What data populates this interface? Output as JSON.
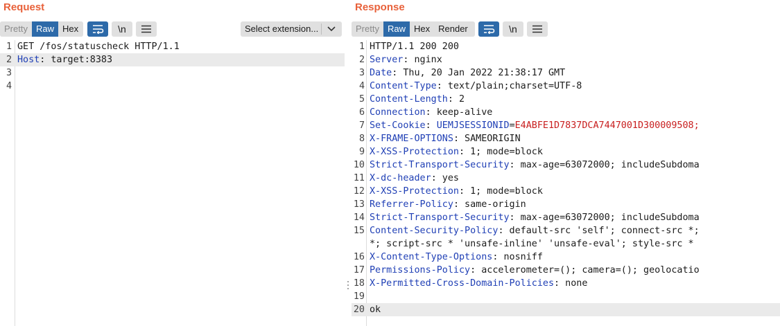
{
  "request": {
    "title": "Request",
    "view_tabs": [
      "Pretty",
      "Raw",
      "Hex"
    ],
    "active_tab": "Raw",
    "newline_label": "\\n",
    "extension_select": "Select extension...",
    "lines": [
      {
        "n": "1",
        "key": "",
        "sep": "",
        "val": "GET /fos/statuscheck HTTP/1.1"
      },
      {
        "n": "2",
        "key": "Host",
        "sep": ":",
        "val": " target:8383"
      },
      {
        "n": "3",
        "key": "",
        "sep": "",
        "val": ""
      },
      {
        "n": "4",
        "key": "",
        "sep": "",
        "val": ""
      }
    ],
    "current_line": 2
  },
  "response": {
    "title": "Response",
    "view_tabs": [
      "Pretty",
      "Raw",
      "Hex",
      "Render"
    ],
    "active_tab": "Raw",
    "newline_label": "\\n",
    "lines": [
      {
        "n": "1",
        "key": "",
        "sep": "",
        "val": "HTTP/1.1 200 200"
      },
      {
        "n": "2",
        "key": "Server",
        "sep": ":",
        "val": " nginx"
      },
      {
        "n": "3",
        "key": "Date",
        "sep": ":",
        "val": " Thu, 20 Jan 2022 21:38:17 GMT"
      },
      {
        "n": "4",
        "key": "Content-Type",
        "sep": ":",
        "val": " text/plain;charset=UTF-8"
      },
      {
        "n": "5",
        "key": "Content-Length",
        "sep": ":",
        "val": " 2"
      },
      {
        "n": "6",
        "key": "Connection",
        "sep": ":",
        "val": " keep-alive"
      },
      {
        "n": "7",
        "key": "Set-Cookie",
        "sep": ":",
        "val": " ",
        "ck": "UEMJSESSIONID",
        "cv": "E4ABFE1D7837DCA7447001D300009508;"
      },
      {
        "n": "8",
        "key": "X-FRAME-OPTIONS",
        "sep": ":",
        "val": " SAMEORIGIN"
      },
      {
        "n": "9",
        "key": "X-XSS-Protection",
        "sep": ":",
        "val": " 1; mode=block"
      },
      {
        "n": "10",
        "key": "Strict-Transport-Security",
        "sep": ":",
        "val": " max-age=63072000; includeSubdoma"
      },
      {
        "n": "11",
        "key": "X-dc-header",
        "sep": ":",
        "val": " yes"
      },
      {
        "n": "12",
        "key": "X-XSS-Protection",
        "sep": ":",
        "val": " 1; mode=block"
      },
      {
        "n": "13",
        "key": "Referrer-Policy",
        "sep": ":",
        "val": " same-origin"
      },
      {
        "n": "14",
        "key": "Strict-Transport-Security",
        "sep": ":",
        "val": " max-age=63072000; includeSubdoma"
      },
      {
        "n": "15",
        "key": "Content-Security-Policy",
        "sep": ":",
        "val": " default-src 'self'; connect-src *;"
      },
      {
        "n": "",
        "key": "",
        "sep": "",
        "val": "*; script-src * 'unsafe-inline' 'unsafe-eval'; style-src *"
      },
      {
        "n": "16",
        "key": "X-Content-Type-Options",
        "sep": ":",
        "val": " nosniff"
      },
      {
        "n": "17",
        "key": "Permissions-Policy",
        "sep": ":",
        "val": " accelerometer=(); camera=(); geolocatio"
      },
      {
        "n": "18",
        "key": "X-Permitted-Cross-Domain-Policies",
        "sep": ":",
        "val": " none"
      },
      {
        "n": "19",
        "key": "",
        "sep": "",
        "val": ""
      },
      {
        "n": "20",
        "key": "",
        "sep": "",
        "val": "ok"
      }
    ],
    "current_line": 21
  },
  "icons": [
    "wrap-lines-icon",
    "newline-icon",
    "menu-icon",
    "chevron-down-icon"
  ],
  "colors": {
    "title": "#e8613a",
    "active": "#2d6aa9",
    "header_key": "#1f3fb5",
    "cookie_value": "#c81e1e"
  }
}
